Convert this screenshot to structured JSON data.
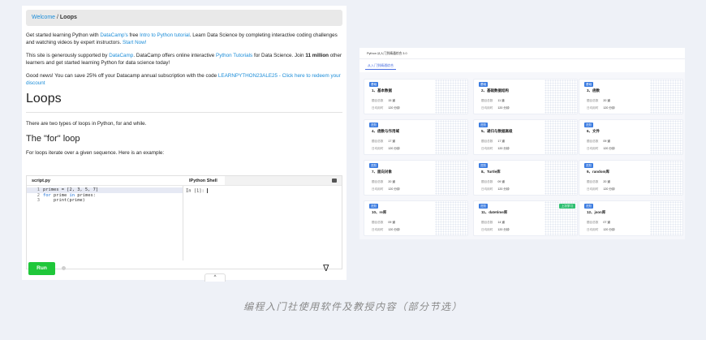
{
  "left": {
    "breadcrumb": {
      "link": "Welcome",
      "separator": " / ",
      "current": "Loops"
    },
    "para1": {
      "t1": "Get started learning Python with ",
      "l1": "DataCamp's",
      "t2": " free ",
      "l2": "Intro to Python tutorial",
      "t3": ". Learn Data Science by completing interactive coding challenges and watching videos by expert instructors. ",
      "l3": "Start Now!"
    },
    "para2": {
      "t1": "This site is generously supported by ",
      "l1": "DataCamp",
      "t2": ". DataCamp offers online interactive ",
      "l2": "Python Tutorials",
      "t3": " for Data Science. Join ",
      "b1": "11 million",
      "t4": " other learners and get started learning Python for data science today!"
    },
    "para3": {
      "t1": "Good news! You can save 25% off your Datacamp annual subscription with the code ",
      "l1": "LEARNPYTHON23ALE25 - Click here to redeem your discount"
    },
    "title": "Loops",
    "intro": "There are two types of loops in Python, for and while.",
    "subtitle": "The \"for\" loop",
    "for_desc": "For loops iterate over a given sequence. Here is an example:",
    "editor": {
      "script_tab": "script.py",
      "shell_tab": "IPython Shell",
      "code": [
        {
          "num": "1",
          "pre": "primes = [2, 3, 5, 7]",
          "kw": "",
          "post": ""
        },
        {
          "num": "2",
          "pre": "",
          "kw": "for",
          "mid": " prime ",
          "kw2": "in",
          "post": " primes:"
        },
        {
          "num": "3",
          "pre": "    print(prime)",
          "kw": "",
          "post": ""
        }
      ],
      "shell_prompt": "In [1]: "
    },
    "run_label": "Run",
    "logo_glyph": "ᐁ",
    "collapse_glyph": "^"
  },
  "right": {
    "top_title": "Python 从入门到精通综合 3.0",
    "tab_label": "从入门到精通综合",
    "row1_label": "题目总数",
    "row2_label": "日均用时",
    "cards": [
      {
        "badge": "基础",
        "title": "1、基本数据",
        "count": "15 道",
        "time": "120 分钟",
        "extra": ""
      },
      {
        "badge": "基础",
        "title": "2、基础数据结构",
        "count": "11 道",
        "time": "120 分钟",
        "extra": ""
      },
      {
        "badge": "基础",
        "title": "3、函数",
        "count": "20 道",
        "time": "120 分钟",
        "extra": ""
      },
      {
        "badge": "进阶",
        "title": "4、函数与作用域",
        "count": "17 道",
        "time": "120 分钟",
        "extra": ""
      },
      {
        "badge": "进阶",
        "title": "5、递归与数据高级",
        "count": "17 道",
        "time": "120 分钟",
        "extra": ""
      },
      {
        "badge": "进阶",
        "title": "6、文件",
        "count": "09 道",
        "time": "120 分钟",
        "extra": ""
      },
      {
        "badge": "进阶",
        "title": "7、面向对象",
        "count": "20 道",
        "time": "120 分钟",
        "extra": ""
      },
      {
        "badge": "进阶",
        "title": "8、Turtle库",
        "count": "09 道",
        "time": "120 分钟",
        "extra": ""
      },
      {
        "badge": "进阶",
        "title": "9、random库",
        "count": "20 道",
        "time": "120 分钟",
        "extra": ""
      },
      {
        "badge": "进阶",
        "title": "10、re库",
        "count": "09 道",
        "time": "120 分钟",
        "extra": ""
      },
      {
        "badge": "进阶",
        "title": "11、datetime库",
        "count": "14 道",
        "time": "120 分钟",
        "extra": "上次学习"
      },
      {
        "badge": "进阶",
        "title": "12、json库",
        "count": "07 道",
        "time": "120 分钟",
        "extra": ""
      }
    ]
  },
  "caption": "编程入门社使用软件及教授内容（部分节选）"
}
